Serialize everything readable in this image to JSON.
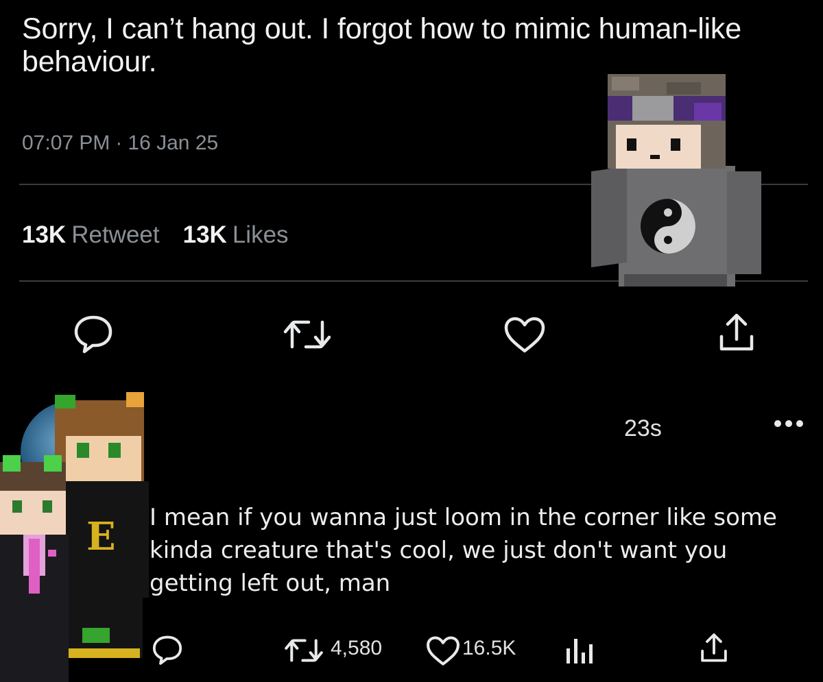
{
  "tweet": {
    "text": "Sorry, I can’t hang out. I forgot how to mimic human-like behaviour.",
    "time": "07:07 PM",
    "separator": "·",
    "date": "16 Jan 25",
    "stats": [
      {
        "count": "13K",
        "label": "Retweet"
      },
      {
        "count": "13K",
        "label": "Likes"
      }
    ],
    "actions": [
      "reply-icon",
      "retweet-icon",
      "like-icon",
      "share-icon"
    ]
  },
  "reply": {
    "time": "23s",
    "text": "I mean if you wanna just loom in the corner like some kinda creature that's cool, we just don't want you getting left out, man",
    "retweets": "4,580",
    "likes": "16.5K",
    "actions": [
      "reply-icon",
      "retweet-icon",
      "like-icon",
      "views-icon",
      "share-icon"
    ]
  },
  "colors": {
    "background": "#000000",
    "text": "#f2f2f2",
    "muted": "#8b9096",
    "divider": "#3a3d40"
  }
}
